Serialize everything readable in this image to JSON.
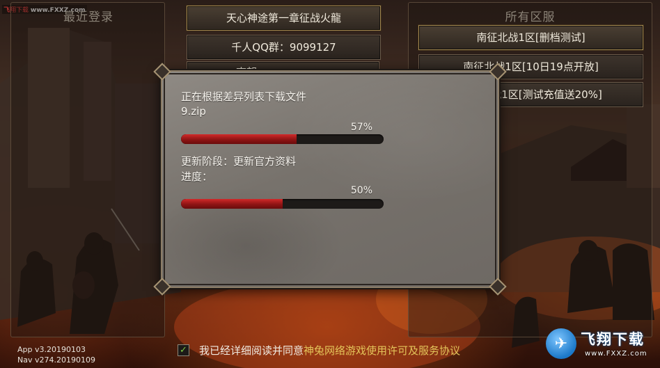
{
  "watermark": {
    "top_left_prefix": "飞翔下载",
    "top_left_url": "www.FXXZ.com",
    "brand_cn": "飞翔下载",
    "brand_url": "www.FXXZ.com"
  },
  "left_panel": {
    "title": "最近登录"
  },
  "center_buttons": [
    {
      "label": "天心神途第一章征战火龍",
      "highlighted": true
    },
    {
      "label": "千人QQ群：9099127",
      "highlighted": false
    },
    {
      "label": "南朝",
      "highlighted": false
    }
  ],
  "right_panel": {
    "title": "所有区服",
    "servers": [
      {
        "label": "南征北战1区[删档测试]",
        "selected": true
      },
      {
        "label": "南征北战1区[10日19点开放]",
        "selected": false
      },
      {
        "label": "南征北战1区[测试充值送20%]",
        "selected": false
      }
    ]
  },
  "download_dialog": {
    "status_line": "正在根据差异列表下载文件",
    "file_name": "9.zip",
    "file_progress_text": "57%",
    "file_progress": 0.57,
    "stage_text": "更新阶段：更新官方资料",
    "overall_label": "进度：",
    "overall_progress_text": "50%",
    "overall_progress": 0.5
  },
  "footer": {
    "app_version": "App v3.20190103",
    "nav_version": "Nav v274.20190109",
    "agreement_checked": true,
    "agreement_prefix": "我已经详细阅读并同意",
    "agreement_link": "神兔网络游戏使用许可及服务协议"
  },
  "colors": {
    "progress_fill": "#b01e1e",
    "link_gold": "#e3c45a",
    "check_green": "#7ec943"
  }
}
